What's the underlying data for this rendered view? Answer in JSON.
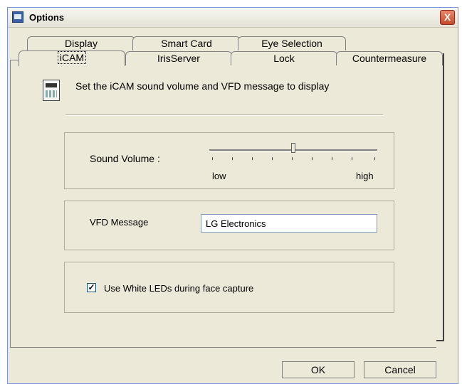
{
  "window": {
    "title": "Options",
    "close_glyph": "X"
  },
  "tabs_back": [
    "Display",
    "Smart Card",
    "Eye Selection"
  ],
  "tabs_front": [
    "iCAM",
    "IrisServer",
    "Lock",
    "Countermeasure"
  ],
  "active_tab": "iCAM",
  "heading": "Set the iCAM sound volume and VFD message to display",
  "sound": {
    "label": "Sound Volume :",
    "low": "low",
    "high": "high",
    "level": 0.5
  },
  "vfd": {
    "label": "VFD Message",
    "value": "LG Electronics"
  },
  "leds": {
    "label": "Use White LEDs during face capture",
    "checked": true
  },
  "buttons": {
    "ok": "OK",
    "cancel": "Cancel"
  }
}
